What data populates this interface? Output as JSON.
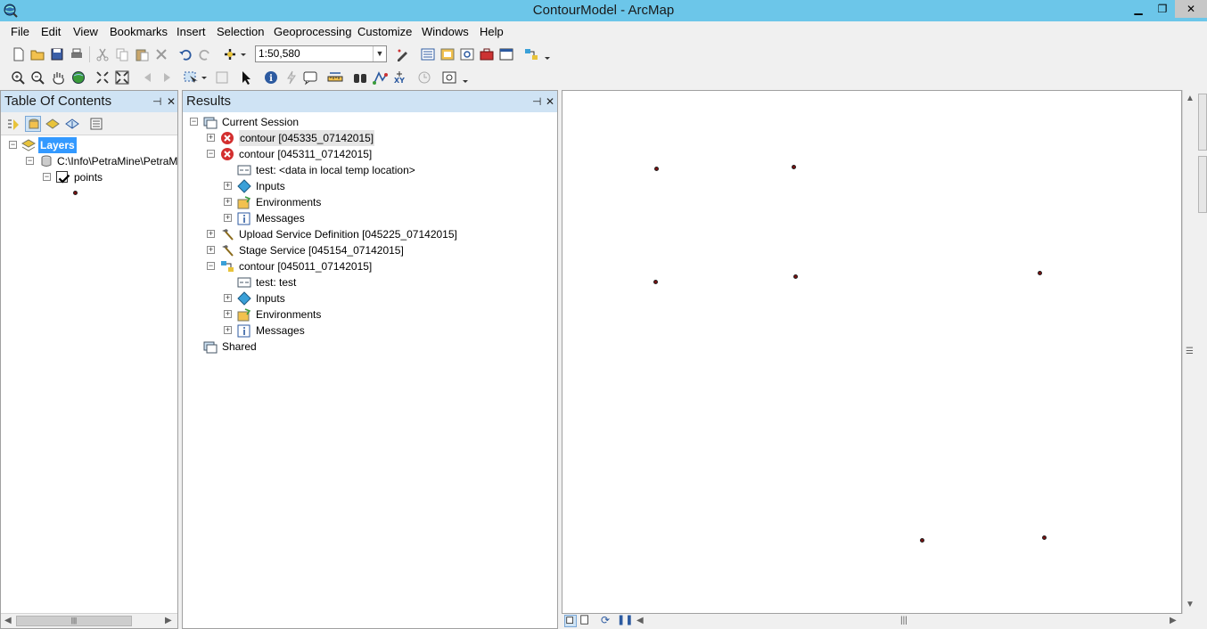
{
  "window": {
    "title": "ContourModel - ArcMap",
    "controls": {
      "minimize": "▁",
      "maximize": "❐",
      "close": "✕"
    }
  },
  "menu": [
    "File",
    "Edit",
    "View",
    "Bookmarks",
    "Insert",
    "Selection",
    "Geoprocessing",
    "Customize",
    "Windows",
    "Help"
  ],
  "toolbar": {
    "scale": "1:50,580"
  },
  "toc": {
    "title": "Table Of Contents",
    "pin": "⊣",
    "close": "✕",
    "tree": {
      "layers_label": "Layers",
      "workspace_path": "C:\\Info\\PetraMine\\PetraM",
      "layer_name": "points"
    }
  },
  "results": {
    "title": "Results",
    "pin": "⊣",
    "close": "✕",
    "items": [
      "Current Session",
      "contour [045335_07142015]",
      "contour [045311_07142015]",
      "test: <data in local temp location>",
      "Inputs",
      "Environments",
      "Messages",
      "Upload Service Definition [045225_07142015]",
      "Stage Service [045154_07142015]",
      "contour [045011_07142015]",
      "test: test",
      "Inputs",
      "Environments",
      "Messages",
      "Shared"
    ]
  },
  "colors": {
    "titlebar": "#6cc6e9",
    "panel_header": "#cfe3f4",
    "point_fill": "#7a1010",
    "error_icon": "#d32f2f",
    "selection": "#3399ff"
  }
}
